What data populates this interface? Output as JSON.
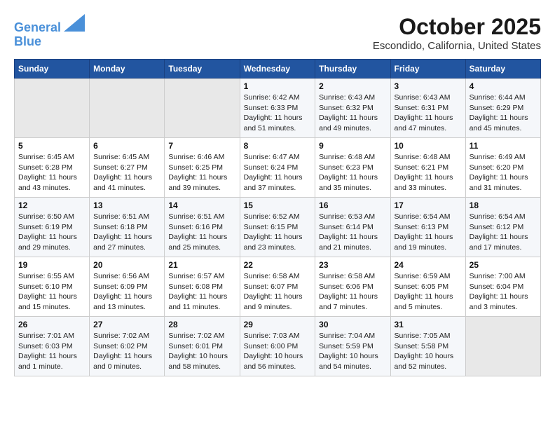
{
  "logo": {
    "line1": "General",
    "line2": "Blue"
  },
  "title": "October 2025",
  "location": "Escondido, California, United States",
  "days_of_week": [
    "Sunday",
    "Monday",
    "Tuesday",
    "Wednesday",
    "Thursday",
    "Friday",
    "Saturday"
  ],
  "weeks": [
    [
      {
        "day": "",
        "sunrise": "",
        "sunset": "",
        "daylight": ""
      },
      {
        "day": "",
        "sunrise": "",
        "sunset": "",
        "daylight": ""
      },
      {
        "day": "",
        "sunrise": "",
        "sunset": "",
        "daylight": ""
      },
      {
        "day": "1",
        "sunrise": "Sunrise: 6:42 AM",
        "sunset": "Sunset: 6:33 PM",
        "daylight": "Daylight: 11 hours and 51 minutes."
      },
      {
        "day": "2",
        "sunrise": "Sunrise: 6:43 AM",
        "sunset": "Sunset: 6:32 PM",
        "daylight": "Daylight: 11 hours and 49 minutes."
      },
      {
        "day": "3",
        "sunrise": "Sunrise: 6:43 AM",
        "sunset": "Sunset: 6:31 PM",
        "daylight": "Daylight: 11 hours and 47 minutes."
      },
      {
        "day": "4",
        "sunrise": "Sunrise: 6:44 AM",
        "sunset": "Sunset: 6:29 PM",
        "daylight": "Daylight: 11 hours and 45 minutes."
      }
    ],
    [
      {
        "day": "5",
        "sunrise": "Sunrise: 6:45 AM",
        "sunset": "Sunset: 6:28 PM",
        "daylight": "Daylight: 11 hours and 43 minutes."
      },
      {
        "day": "6",
        "sunrise": "Sunrise: 6:45 AM",
        "sunset": "Sunset: 6:27 PM",
        "daylight": "Daylight: 11 hours and 41 minutes."
      },
      {
        "day": "7",
        "sunrise": "Sunrise: 6:46 AM",
        "sunset": "Sunset: 6:25 PM",
        "daylight": "Daylight: 11 hours and 39 minutes."
      },
      {
        "day": "8",
        "sunrise": "Sunrise: 6:47 AM",
        "sunset": "Sunset: 6:24 PM",
        "daylight": "Daylight: 11 hours and 37 minutes."
      },
      {
        "day": "9",
        "sunrise": "Sunrise: 6:48 AM",
        "sunset": "Sunset: 6:23 PM",
        "daylight": "Daylight: 11 hours and 35 minutes."
      },
      {
        "day": "10",
        "sunrise": "Sunrise: 6:48 AM",
        "sunset": "Sunset: 6:21 PM",
        "daylight": "Daylight: 11 hours and 33 minutes."
      },
      {
        "day": "11",
        "sunrise": "Sunrise: 6:49 AM",
        "sunset": "Sunset: 6:20 PM",
        "daylight": "Daylight: 11 hours and 31 minutes."
      }
    ],
    [
      {
        "day": "12",
        "sunrise": "Sunrise: 6:50 AM",
        "sunset": "Sunset: 6:19 PM",
        "daylight": "Daylight: 11 hours and 29 minutes."
      },
      {
        "day": "13",
        "sunrise": "Sunrise: 6:51 AM",
        "sunset": "Sunset: 6:18 PM",
        "daylight": "Daylight: 11 hours and 27 minutes."
      },
      {
        "day": "14",
        "sunrise": "Sunrise: 6:51 AM",
        "sunset": "Sunset: 6:16 PM",
        "daylight": "Daylight: 11 hours and 25 minutes."
      },
      {
        "day": "15",
        "sunrise": "Sunrise: 6:52 AM",
        "sunset": "Sunset: 6:15 PM",
        "daylight": "Daylight: 11 hours and 23 minutes."
      },
      {
        "day": "16",
        "sunrise": "Sunrise: 6:53 AM",
        "sunset": "Sunset: 6:14 PM",
        "daylight": "Daylight: 11 hours and 21 minutes."
      },
      {
        "day": "17",
        "sunrise": "Sunrise: 6:54 AM",
        "sunset": "Sunset: 6:13 PM",
        "daylight": "Daylight: 11 hours and 19 minutes."
      },
      {
        "day": "18",
        "sunrise": "Sunrise: 6:54 AM",
        "sunset": "Sunset: 6:12 PM",
        "daylight": "Daylight: 11 hours and 17 minutes."
      }
    ],
    [
      {
        "day": "19",
        "sunrise": "Sunrise: 6:55 AM",
        "sunset": "Sunset: 6:10 PM",
        "daylight": "Daylight: 11 hours and 15 minutes."
      },
      {
        "day": "20",
        "sunrise": "Sunrise: 6:56 AM",
        "sunset": "Sunset: 6:09 PM",
        "daylight": "Daylight: 11 hours and 13 minutes."
      },
      {
        "day": "21",
        "sunrise": "Sunrise: 6:57 AM",
        "sunset": "Sunset: 6:08 PM",
        "daylight": "Daylight: 11 hours and 11 minutes."
      },
      {
        "day": "22",
        "sunrise": "Sunrise: 6:58 AM",
        "sunset": "Sunset: 6:07 PM",
        "daylight": "Daylight: 11 hours and 9 minutes."
      },
      {
        "day": "23",
        "sunrise": "Sunrise: 6:58 AM",
        "sunset": "Sunset: 6:06 PM",
        "daylight": "Daylight: 11 hours and 7 minutes."
      },
      {
        "day": "24",
        "sunrise": "Sunrise: 6:59 AM",
        "sunset": "Sunset: 6:05 PM",
        "daylight": "Daylight: 11 hours and 5 minutes."
      },
      {
        "day": "25",
        "sunrise": "Sunrise: 7:00 AM",
        "sunset": "Sunset: 6:04 PM",
        "daylight": "Daylight: 11 hours and 3 minutes."
      }
    ],
    [
      {
        "day": "26",
        "sunrise": "Sunrise: 7:01 AM",
        "sunset": "Sunset: 6:03 PM",
        "daylight": "Daylight: 11 hours and 1 minute."
      },
      {
        "day": "27",
        "sunrise": "Sunrise: 7:02 AM",
        "sunset": "Sunset: 6:02 PM",
        "daylight": "Daylight: 11 hours and 0 minutes."
      },
      {
        "day": "28",
        "sunrise": "Sunrise: 7:02 AM",
        "sunset": "Sunset: 6:01 PM",
        "daylight": "Daylight: 10 hours and 58 minutes."
      },
      {
        "day": "29",
        "sunrise": "Sunrise: 7:03 AM",
        "sunset": "Sunset: 6:00 PM",
        "daylight": "Daylight: 10 hours and 56 minutes."
      },
      {
        "day": "30",
        "sunrise": "Sunrise: 7:04 AM",
        "sunset": "Sunset: 5:59 PM",
        "daylight": "Daylight: 10 hours and 54 minutes."
      },
      {
        "day": "31",
        "sunrise": "Sunrise: 7:05 AM",
        "sunset": "Sunset: 5:58 PM",
        "daylight": "Daylight: 10 hours and 52 minutes."
      },
      {
        "day": "",
        "sunrise": "",
        "sunset": "",
        "daylight": ""
      }
    ]
  ]
}
